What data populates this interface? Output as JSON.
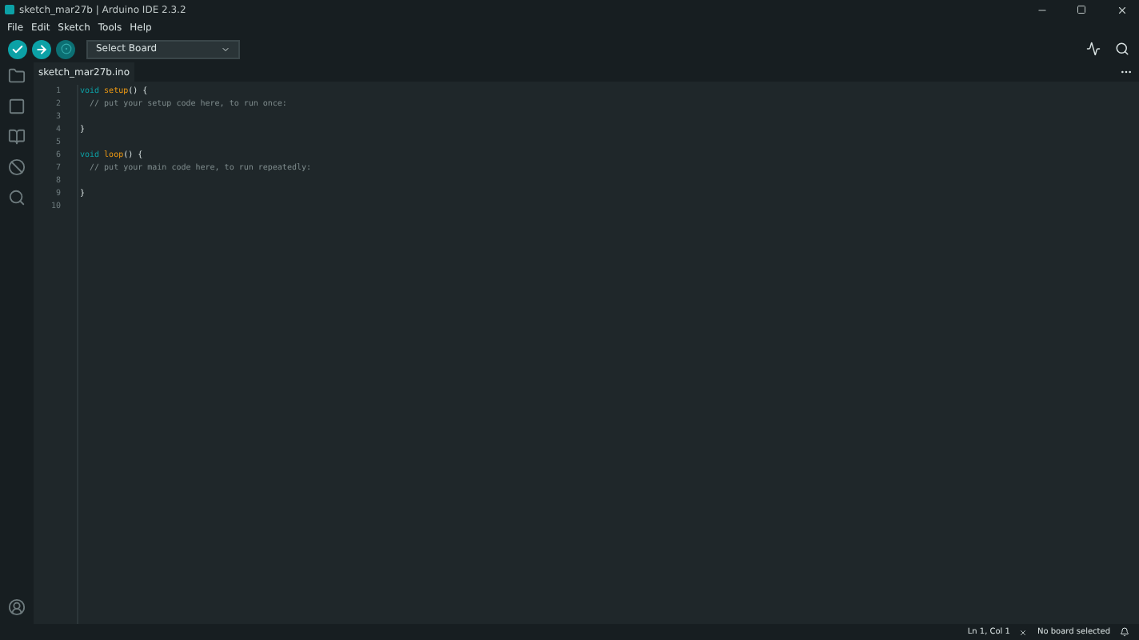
{
  "window": {
    "title": "sketch_mar27b | Arduino IDE 2.3.2"
  },
  "menu": [
    "File",
    "Edit",
    "Sketch",
    "Tools",
    "Help"
  ],
  "board_select": {
    "label": "Select Board"
  },
  "editor": {
    "tab": "sketch_mar27b.ino",
    "lines": [
      {
        "number": "1",
        "tokens": [
          {
            "kind": "keyword",
            "text": "void"
          },
          {
            "kind": "function",
            "text": "setup"
          },
          {
            "kind": "plain",
            "text": "() {"
          }
        ]
      },
      {
        "number": "2",
        "tokens": [
          {
            "kind": "comment",
            "text": "  // put your setup code here, to run once:"
          }
        ]
      },
      {
        "number": "3"
      },
      {
        "number": "4",
        "tokens": [
          {
            "kind": "plain",
            "text": "}"
          }
        ]
      },
      {
        "number": "5"
      },
      {
        "number": "6",
        "tokens": [
          {
            "kind": "keyword",
            "text": "void"
          },
          {
            "kind": "function",
            "text": "loop"
          },
          {
            "kind": "plain",
            "text": "() {"
          }
        ]
      },
      {
        "number": "7",
        "tokens": [
          {
            "kind": "comment",
            "text": "  // put your main code here, to run repeatedly:"
          }
        ]
      },
      {
        "number": "8"
      },
      {
        "number": "9",
        "tokens": [
          {
            "kind": "plain",
            "text": "}"
          }
        ]
      },
      {
        "number": "10"
      }
    ]
  },
  "status_bar": {
    "position": "Ln 1, Col 1",
    "board": "No board selected"
  }
}
